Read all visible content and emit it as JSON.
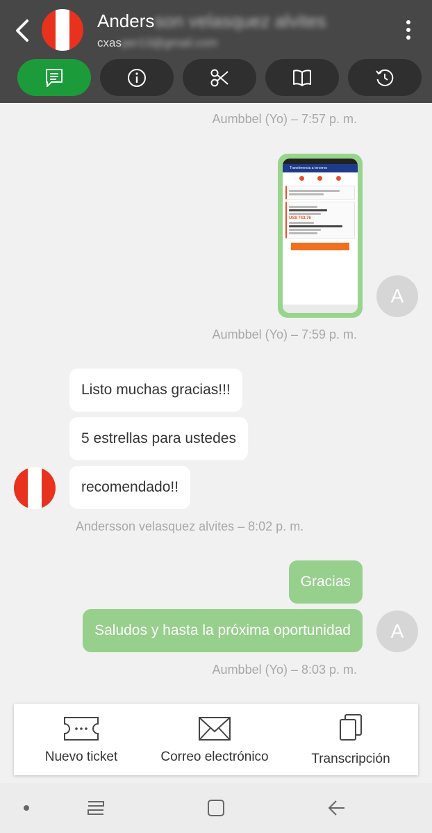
{
  "header": {
    "name_visible": "Anders",
    "name_hidden": "son velasquez alvites",
    "email_visible": "cxas",
    "email_hidden": "per13@gmail.com"
  },
  "tabs": [
    {
      "icon": "chat-icon",
      "active": true
    },
    {
      "icon": "info-icon",
      "active": false
    },
    {
      "icon": "scissors-icon",
      "active": false
    },
    {
      "icon": "book-icon",
      "active": false
    },
    {
      "icon": "history-icon",
      "active": false
    }
  ],
  "messages": {
    "ts1": "Aumbbel (Yo) – 7:57 p. m.",
    "image_attachment": {
      "app_title": "Transferencia a terceros",
      "amount": "US$ 743.76"
    },
    "ts2": "Aumbbel (Yo) – 7:59 p. m.",
    "in1": "Listo muchas gracias!!!",
    "in2": "5 estrellas para ustedes",
    "in3": "recomendado!!",
    "ts3": "Andersson velasquez alvites – 8:02 p. m.",
    "out1": "Gracias",
    "out2": "Saludos y hasta la próxima oportunidad",
    "ts4": "Aumbbel (Yo) – 8:03 p. m.",
    "agent_initial": "A"
  },
  "actions": {
    "new_ticket": "Nuevo ticket",
    "email": "Correo electrónico",
    "transcript": "Transcripción"
  },
  "colors": {
    "header_bg": "#474747",
    "tab_active": "#1c9b3b",
    "outgoing_bubble": "#97cf8c",
    "flag_red": "#e8321e"
  }
}
